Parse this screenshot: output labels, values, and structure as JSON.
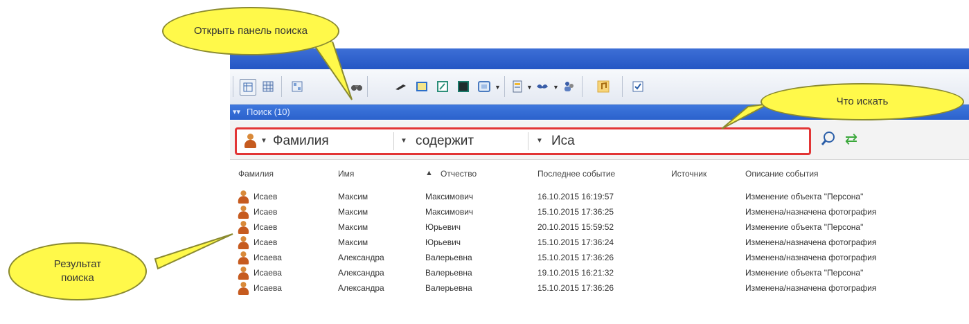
{
  "toolbar": {
    "icons": [
      "grid-small-icon",
      "grid-large-icon",
      "grid-detail-icon",
      "binoculars-icon",
      "pen-icon",
      "card-icon",
      "edit-icon",
      "screen-icon",
      "monitor-icon",
      "report-icon",
      "bird-icon",
      "users-icon",
      "music-icon",
      "checkbox-icon"
    ]
  },
  "panel": {
    "title": "Поиск (10)"
  },
  "search": {
    "field": "Фамилия",
    "condition": "содержит",
    "value": "Иса"
  },
  "table": {
    "columns": [
      "Фамилия",
      "Имя",
      "Отчество",
      "Последнее событие",
      "Источник",
      "Описание события"
    ],
    "sort_indicator": "▲",
    "rows": [
      {
        "surname": "Исаев",
        "name": "Максим",
        "patronymic": "Максимович",
        "last_event": "16.10.2015 16:19:57",
        "source": "",
        "description": "Изменение объекта \"Персона\""
      },
      {
        "surname": "Исаев",
        "name": "Максим",
        "patronymic": "Максимович",
        "last_event": "15.10.2015 17:36:25",
        "source": "",
        "description": "Изменена/назначена фотография"
      },
      {
        "surname": "Исаев",
        "name": "Максим",
        "patronymic": "Юрьевич",
        "last_event": "20.10.2015 15:59:52",
        "source": "",
        "description": "Изменение объекта \"Персона\""
      },
      {
        "surname": "Исаев",
        "name": "Максим",
        "patronymic": "Юрьевич",
        "last_event": "15.10.2015 17:36:24",
        "source": "",
        "description": "Изменена/назначена фотография"
      },
      {
        "surname": "Исаева",
        "name": "Александра",
        "patronymic": "Валерьевна",
        "last_event": "15.10.2015 17:36:26",
        "source": "",
        "description": "Изменена/назначена фотография"
      },
      {
        "surname": "Исаева",
        "name": "Александра",
        "patronymic": "Валерьевна",
        "last_event": "19.10.2015 16:21:32",
        "source": "",
        "description": "Изменение объекта \"Персона\""
      },
      {
        "surname": "Исаева",
        "name": "Александра",
        "patronymic": "Валерьевна",
        "last_event": "15.10.2015 17:36:26",
        "source": "",
        "description": "Изменена/назначена фотография"
      }
    ]
  },
  "callouts": {
    "open_search": "Открыть панель поиска",
    "what_to_search": "Что искать",
    "search_result": "Результат поиска"
  },
  "colors": {
    "titlebar": "#2456c4",
    "panelbar": "#2b62cc",
    "search_highlight": "#e23535",
    "callout": "#fff94a",
    "person_icon": "#c65b1f"
  }
}
